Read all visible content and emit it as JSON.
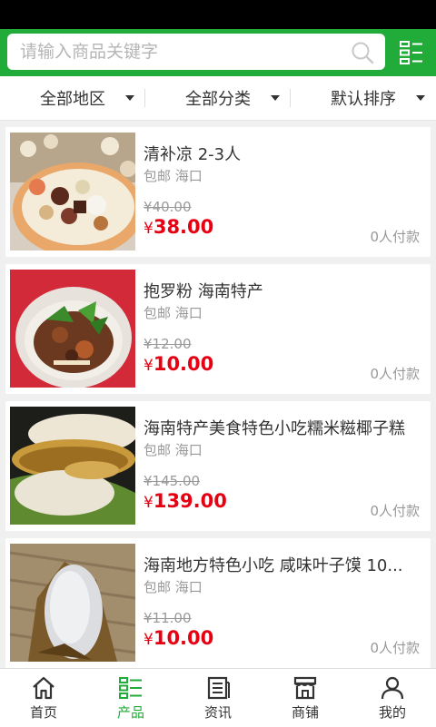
{
  "search": {
    "placeholder": "请输入商品关键字",
    "value": ""
  },
  "filters": [
    {
      "label": "全部地区"
    },
    {
      "label": "全部分类"
    },
    {
      "label": "默认排序"
    }
  ],
  "products": [
    {
      "title": "清补凉 2-3人",
      "meta": "包邮 海口",
      "old_price": "¥40.00",
      "yen": "¥",
      "price": "38.00",
      "sold": "0人付款"
    },
    {
      "title": "抱罗粉 海南特产",
      "meta": "包邮 海口",
      "old_price": "¥12.00",
      "yen": "¥",
      "price": "10.00",
      "sold": "0人付款"
    },
    {
      "title": "海南特产美食特色小吃糯米糍椰子糕",
      "meta": "包邮 海口",
      "old_price": "¥145.00",
      "yen": "¥",
      "price": "139.00",
      "sold": "0人付款"
    },
    {
      "title": "海南地方特色小吃 咸味叶子馍 10...",
      "meta": "包邮 海口",
      "old_price": "¥11.00",
      "yen": "¥",
      "price": "10.00",
      "sold": "0人付款"
    }
  ],
  "tabs": [
    {
      "label": "首页",
      "icon": "home-icon"
    },
    {
      "label": "产品",
      "icon": "list-icon",
      "active": true
    },
    {
      "label": "资讯",
      "icon": "news-icon"
    },
    {
      "label": "商铺",
      "icon": "shop-icon"
    },
    {
      "label": "我的",
      "icon": "user-icon"
    }
  ],
  "colors": {
    "brand": "#21ac39",
    "price": "#e60012",
    "muted": "#999999"
  }
}
